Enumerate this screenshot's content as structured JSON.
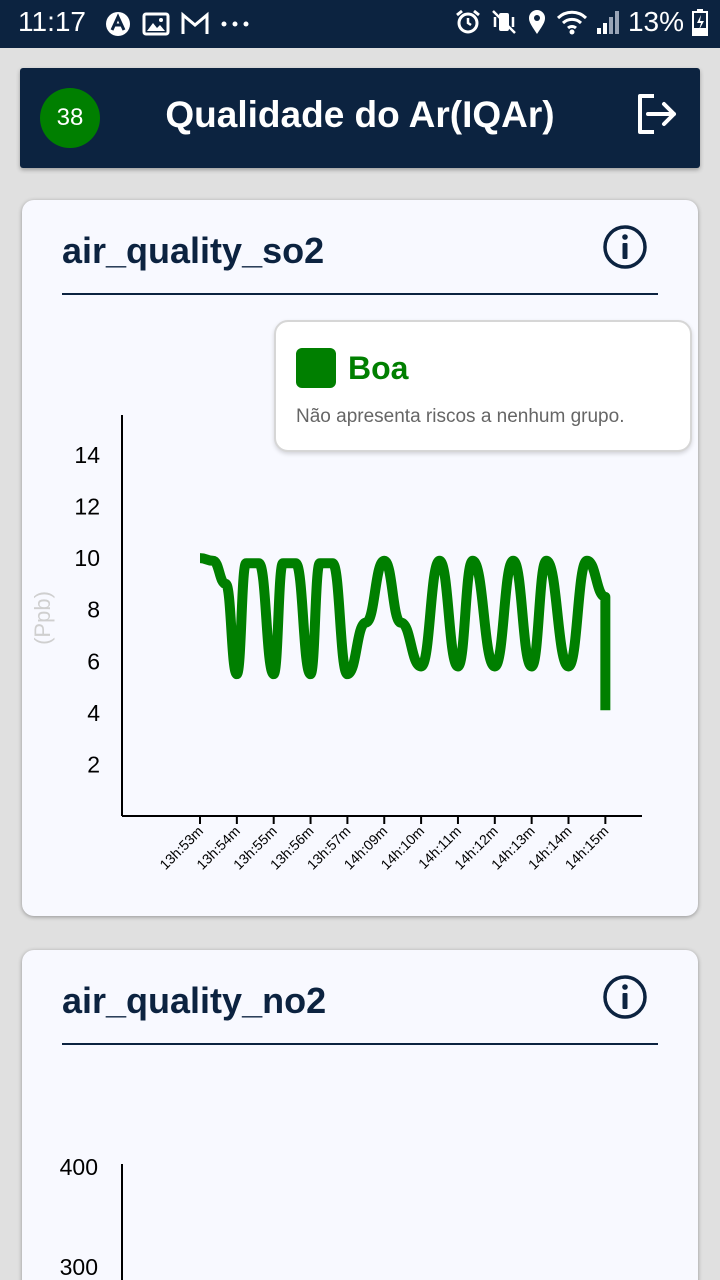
{
  "status_bar": {
    "time": "11:17",
    "battery_percent": "13%",
    "left_icons": [
      "autodesk-icon",
      "image-icon",
      "gmail-icon",
      "more-dots-icon"
    ],
    "right_icons": [
      "alarm-icon",
      "vibrate-icon",
      "location-icon",
      "wifi-icon",
      "signal-icon",
      "battery-charging-icon"
    ]
  },
  "app_bar": {
    "badge_value": "38",
    "badge_color": "#007f00",
    "title": "Qualidade do Ar(IQAr)",
    "logout_icon": "logout-icon"
  },
  "cards": [
    {
      "title": "air_quality_so2",
      "info_icon": "info-icon",
      "tooltip": {
        "swatch_color": "#007f00",
        "title": "Boa",
        "description": "Não apresenta riscos a nenhum grupo."
      }
    },
    {
      "title": "air_quality_no2",
      "info_icon": "info-icon"
    }
  ],
  "chart_data": [
    {
      "type": "line",
      "ylabel": "(Ppb)",
      "ylim": [
        0,
        15
      ],
      "yticks": [
        2,
        4,
        6,
        8,
        10,
        12,
        14
      ],
      "line_color": "#007f00",
      "categories": [
        "13h:53m",
        "13h:54m",
        "13h:55m",
        "13h:56m",
        "13h:57m",
        "14h:09m",
        "14h:10m",
        "14h:11m",
        "14h:12m",
        "14h:13m",
        "14h:14m",
        "14h:15m"
      ],
      "series": [
        {
          "x": [
            0,
            0.35,
            0.7,
            1.0,
            1.25,
            1.6,
            2.0,
            2.25,
            2.6,
            3.0,
            3.25,
            3.6,
            4.0,
            4.5,
            5.0,
            5.45,
            6.0,
            6.5,
            7.0,
            7.4,
            8.0,
            8.5,
            9.0,
            9.4,
            10.0,
            10.5,
            11.0,
            11.0
          ],
          "y": [
            10,
            9.9,
            9,
            5.5,
            9.8,
            9.8,
            5.5,
            9.8,
            9.8,
            5.5,
            9.8,
            9.8,
            5.5,
            7.5,
            9.9,
            7.5,
            5.8,
            9.9,
            5.8,
            9.9,
            5.8,
            9.9,
            5.8,
            9.9,
            5.8,
            9.9,
            8.5,
            4.1
          ]
        }
      ]
    },
    {
      "type": "line",
      "yticks": [
        300,
        400
      ],
      "ylim": [
        250,
        420
      ],
      "line_color": "#007f00",
      "categories": [],
      "series": []
    }
  ]
}
